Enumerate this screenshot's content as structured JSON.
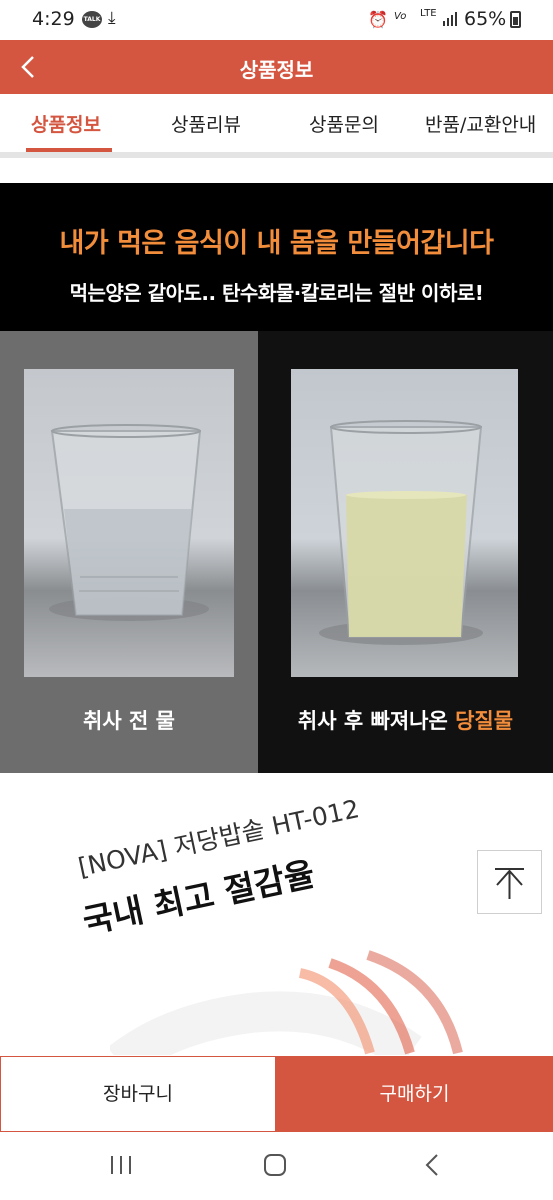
{
  "status_bar": {
    "time": "4:29",
    "talk_badge": "TALK",
    "volte": "Vo)) LTE",
    "lte": "LTE",
    "battery": "65%"
  },
  "header": {
    "title": "상품정보",
    "back_icon": "chevron-left-icon"
  },
  "tabs": [
    {
      "label": "상품정보",
      "active": true
    },
    {
      "label": "상품리뷰",
      "active": false
    },
    {
      "label": "상품문의",
      "active": false
    },
    {
      "label": "반품/교환안내",
      "active": false
    }
  ],
  "banner": {
    "headline": "내가 먹은 음식이 내 몸을 만들어갑니다",
    "subline": "먹는양은 같아도.. 탄수화물·칼로리는 절반 이하로!",
    "left_caption": "취사 전 물",
    "right_caption_prefix": "취사 후 빠져나온 ",
    "right_caption_highlight": "당질물"
  },
  "promo": {
    "line1": "[NOVA] 저당밥솥 HT-012",
    "line2": "국내 최고 절감율"
  },
  "scroll_top": {
    "icon": "arrow-up-to-top-icon"
  },
  "bottom_bar": {
    "cart_label": "장바구니",
    "buy_label": "구매하기"
  },
  "nav_bar": {
    "recents_icon": "recents-icon",
    "home_icon": "home-icon",
    "back_icon": "back-icon"
  },
  "colors": {
    "accent": "#d55640",
    "highlight_orange": "#f28d3c",
    "banner_bg": "#000000",
    "left_panel_bg": "#6d6d6d"
  }
}
